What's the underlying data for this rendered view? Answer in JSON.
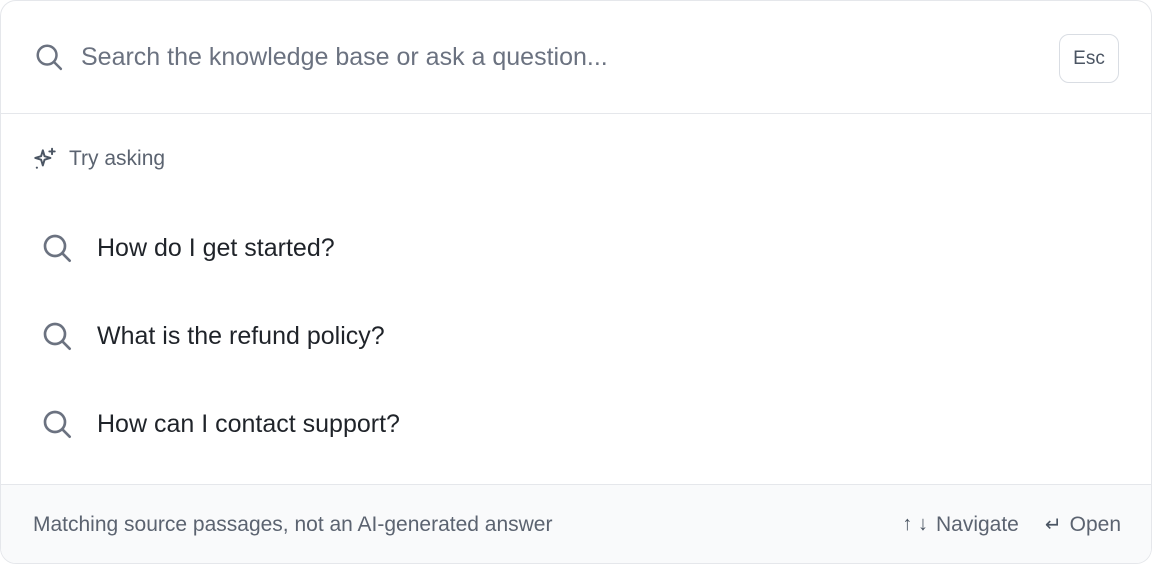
{
  "search": {
    "placeholder": "Search the knowledge base or ask a question...",
    "value": "",
    "icon": "search-icon",
    "esc_label": "Esc"
  },
  "suggestions": {
    "header_icon": "sparkles-icon",
    "header_label": "Try asking",
    "items": [
      {
        "icon": "search-icon",
        "label": "How do I get started?"
      },
      {
        "icon": "search-icon",
        "label": "What is the refund policy?"
      },
      {
        "icon": "search-icon",
        "label": "How can I contact support?"
      }
    ]
  },
  "footer": {
    "note": "Matching source passages, not an AI-generated answer",
    "navigate_keys": "↑ ↓",
    "navigate_label": "Navigate",
    "open_key": "↵",
    "open_label": "Open"
  },
  "colors": {
    "border": "#e5e7eb",
    "footer_bg": "#f9fafb",
    "muted_text": "#5b6370",
    "primary_text": "#1f2329",
    "icon": "#6b7280"
  }
}
